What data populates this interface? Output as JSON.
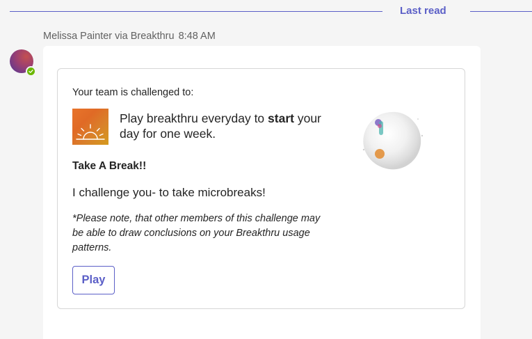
{
  "divider": {
    "label": "Last read"
  },
  "message": {
    "sender": "Melissa Painter via Breakthru",
    "time": "8:48 AM",
    "presence_status": "available",
    "card": {
      "intro": "Your team is challenged to:",
      "challenge_text_before": "Play breakthru everyday to ",
      "challenge_text_bold": "start",
      "challenge_text_after": " your day for one week.",
      "title": "Take A Break!!",
      "description": "I challenge you- to take microbreaks!",
      "disclaimer": "*Please note, that other members of this challenge may be able to draw conclusions on your Breakthru usage patterns.",
      "play_button": "Play"
    }
  },
  "colors": {
    "accent": "#5b5fc7",
    "presence": "#6bb700",
    "logo_orange": "#e8742b"
  }
}
